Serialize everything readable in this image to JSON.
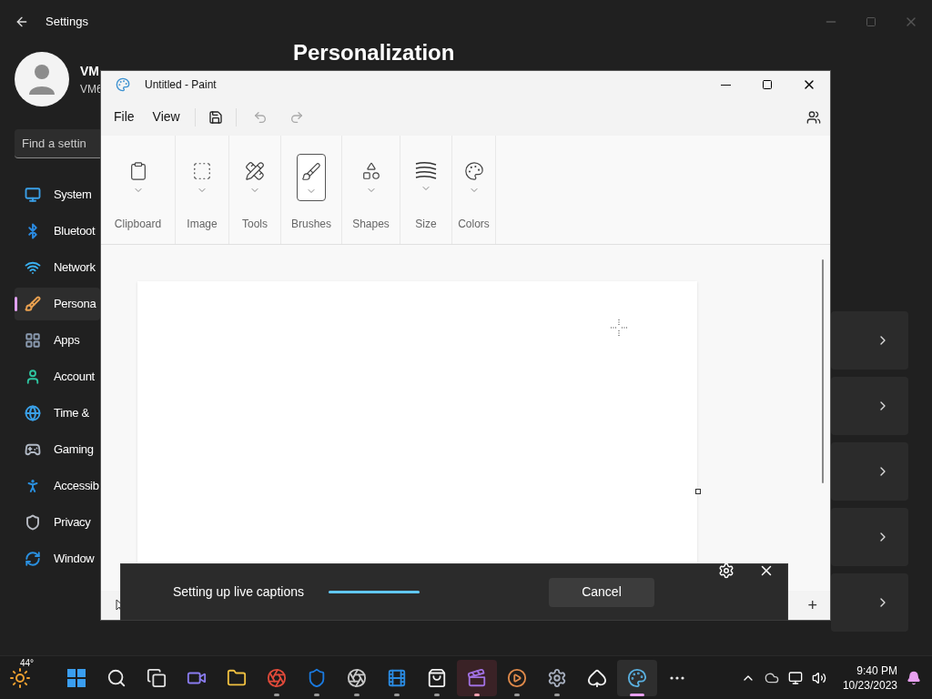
{
  "settings": {
    "title": "Settings",
    "profile": {
      "name": "VM",
      "account": "VM6"
    },
    "search": {
      "placeholder": "Find a settin"
    },
    "nav": [
      {
        "label": "System",
        "selected": false
      },
      {
        "label": "Bluetoot",
        "selected": false
      },
      {
        "label": "Network",
        "selected": false
      },
      {
        "label": "Persona",
        "selected": true
      },
      {
        "label": "Apps",
        "selected": false
      },
      {
        "label": "Account",
        "selected": false
      },
      {
        "label": "Time &",
        "selected": false
      },
      {
        "label": "Gaming",
        "selected": false
      },
      {
        "label": "Accessib",
        "selected": false
      },
      {
        "label": "Privacy",
        "selected": false
      },
      {
        "label": "Window",
        "selected": false
      }
    ],
    "heading": "Personalization"
  },
  "paint": {
    "title": "Untitled - Paint",
    "menu": [
      "File",
      "View"
    ],
    "ribbon": [
      {
        "label": "Clipboard",
        "selected": false
      },
      {
        "label": "Image",
        "selected": false
      },
      {
        "label": "Tools",
        "selected": false
      },
      {
        "label": "Brushes",
        "selected": true
      },
      {
        "label": "Shapes",
        "selected": false
      },
      {
        "label": "Size",
        "selected": false
      },
      {
        "label": "Colors",
        "selected": false
      }
    ],
    "zoom_in": "+"
  },
  "captions": {
    "message": "Setting up live captions",
    "level": 1,
    "button": "Cancel"
  },
  "taskbar": {
    "weather": "44°",
    "apps": [
      {
        "running": false,
        "selected": false,
        "attention": false
      },
      {
        "running": false,
        "selected": false,
        "attention": false
      },
      {
        "running": false,
        "selected": false,
        "attention": false
      },
      {
        "running": false,
        "selected": false,
        "attention": false
      },
      {
        "running": false,
        "selected": false,
        "attention": false
      },
      {
        "running": true,
        "selected": false,
        "attention": false
      },
      {
        "running": true,
        "selected": false,
        "attention": false
      },
      {
        "running": true,
        "selected": false,
        "attention": false
      },
      {
        "running": true,
        "selected": false,
        "attention": false
      },
      {
        "running": true,
        "selected": false,
        "attention": false
      },
      {
        "running": true,
        "selected": false,
        "attention": true
      },
      {
        "running": true,
        "selected": false,
        "attention": false
      },
      {
        "running": true,
        "selected": false,
        "attention": false
      },
      {
        "running": false,
        "selected": false,
        "attention": false
      },
      {
        "running": true,
        "selected": true,
        "attention": false
      },
      {
        "running": false,
        "selected": false,
        "attention": false
      }
    ],
    "time": "9:40 PM",
    "date": "10/23/2023"
  }
}
